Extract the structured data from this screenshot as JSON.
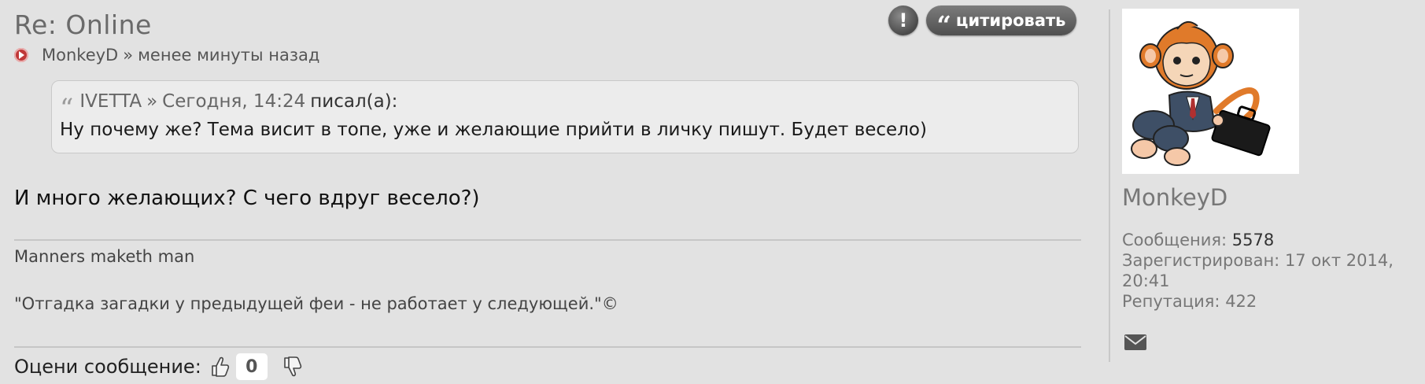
{
  "post": {
    "title": "Re: Online",
    "author": "MonkeyD",
    "separator": "»",
    "time": "менее минуты назад",
    "report_label": "!",
    "quote_button": "цитировать",
    "quote": {
      "author": "IVETTA",
      "separator": "»",
      "date": "Сегодня, 14:24",
      "says": "писал(а):",
      "text": "Ну почему же? Тема висит в топе, уже и желающие прийти в личку пишут. Будет весело)"
    },
    "body": "И много желающих? С чего вдруг весело?)",
    "signature": {
      "line1": "Manners maketh man",
      "line2": "\"Отгадка загадки у предыдущей феи - не работает у следующей.\"©"
    },
    "rating": {
      "label": "Оцени сообщение:",
      "score": "0"
    }
  },
  "sidebar": {
    "username": "MonkeyD",
    "messages_label": "Сообщения:",
    "messages": "5578",
    "registered_label": "Зарегистрирован:",
    "registered": "17 окт 2014, 20:41",
    "reputation_label": "Репутация:",
    "reputation": "422"
  },
  "colors": {
    "background": "#e2e2e2",
    "button_dark": "#5a5a5a",
    "meta_icon": "#c03838"
  },
  "icons": [
    "play-circle-icon",
    "exclamation-icon",
    "quote-icon",
    "thumbs-up-icon",
    "thumbs-down-icon",
    "envelope-icon",
    "monkey-avatar"
  ]
}
